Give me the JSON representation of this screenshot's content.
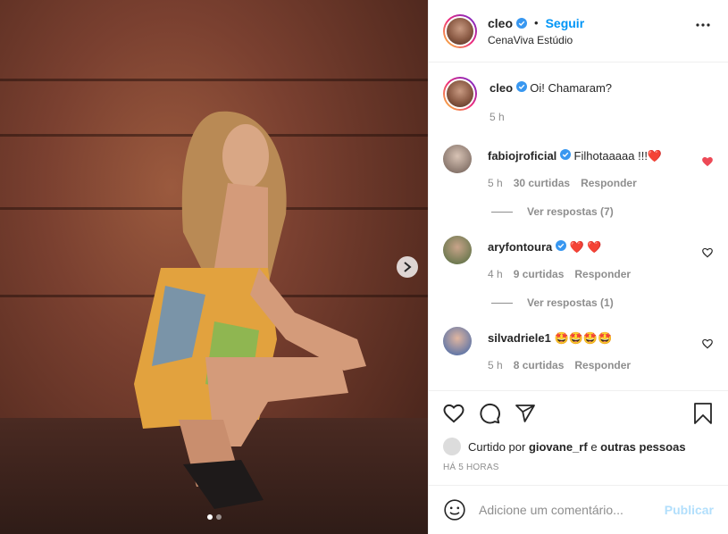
{
  "header": {
    "username": "cleo",
    "follow_label": "Seguir",
    "separator": "•",
    "location": "CenaViva Estúdio"
  },
  "caption": {
    "username": "cleo",
    "text": "Oi! Chamaram?",
    "time": "5 h"
  },
  "comments": [
    {
      "username": "fabiojroficial",
      "text": "Filhotaaaaa !!!❤️",
      "time": "5 h",
      "likes": "30 curtidas",
      "reply": "Responder",
      "view_replies": "Ver respostas (7)",
      "liked": true
    },
    {
      "username": "aryfontoura",
      "text": "❤️ ❤️",
      "time": "4 h",
      "likes": "9 curtidas",
      "reply": "Responder",
      "view_replies": "Ver respostas (1)",
      "liked": false
    },
    {
      "username": "silvadriele1",
      "text": "🤩🤩🤩🤩",
      "time": "5 h",
      "likes": "8 curtidas",
      "reply": "Responder",
      "liked": false
    }
  ],
  "likes": {
    "prefix": "Curtido por",
    "user": "giovane_rf",
    "middle": "e",
    "suffix": "outras pessoas"
  },
  "timestamp": "HÁ 5 HORAS",
  "add_comment": {
    "placeholder": "Adicione um comentário...",
    "publish_label": "Publicar"
  },
  "carousel": {
    "count": 2,
    "active": 0
  },
  "colors": {
    "accent": "#0095f6",
    "heart": "#ed4956",
    "muted": "#8e8e8e",
    "publish_disabled": "#b2dffc"
  },
  "icons": [
    "more-icon",
    "verified-icon",
    "heart-icon",
    "comment-icon",
    "share-icon",
    "bookmark-icon",
    "emoji-icon",
    "chevron-right-icon"
  ]
}
